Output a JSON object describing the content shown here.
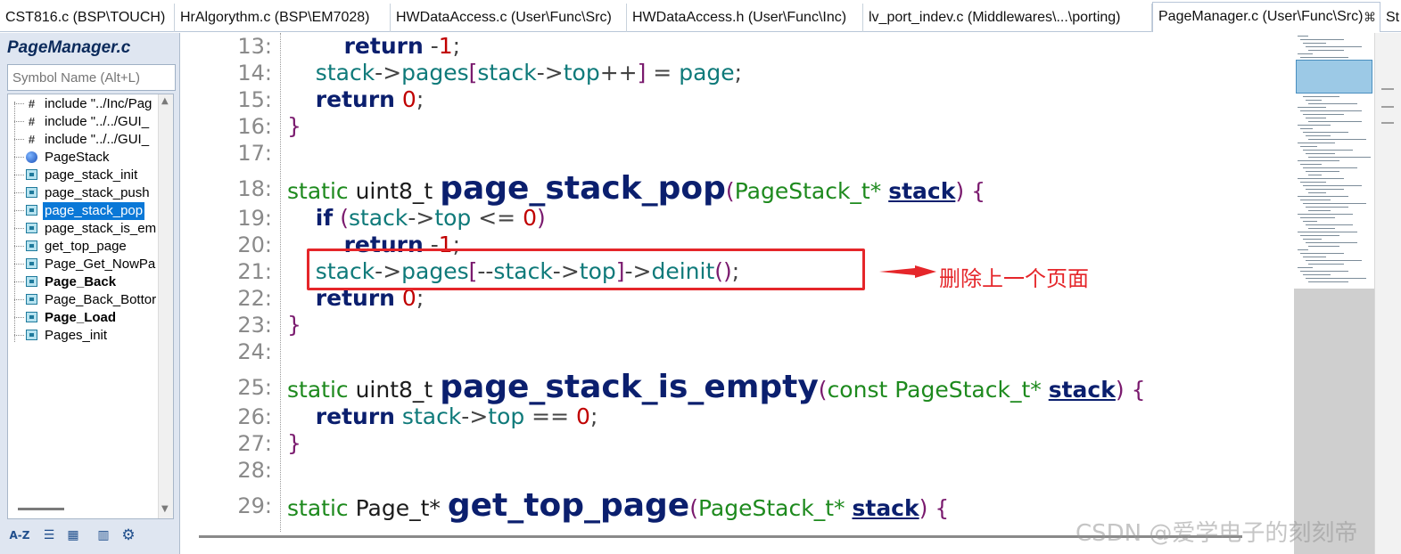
{
  "tabs": [
    {
      "label": "CST816.c (BSP\\TOUCH)",
      "active": false
    },
    {
      "label": "HrAlgorythm.c (BSP\\EM7028)",
      "active": false
    },
    {
      "label": "HWDataAccess.c (User\\Func\\Src)",
      "active": false
    },
    {
      "label": "HWDataAccess.h (User\\Func\\Inc)",
      "active": false
    },
    {
      "label": "lv_port_indev.c (Middlewares\\...\\porting)",
      "active": false
    },
    {
      "label": "PageManager.c (User\\Func\\Src)",
      "active": true
    },
    {
      "label": "St",
      "active": false
    }
  ],
  "tab_close_glyph": "⌘",
  "symbol_panel": {
    "title": "PageManager.c",
    "search_placeholder": "Symbol Name (Alt+L)",
    "items": [
      {
        "label": "include \"../Inc/Pag",
        "icon": "include-hash-icon",
        "bold": false,
        "selected": false
      },
      {
        "label": "include \"../../GUI_",
        "icon": "include-hash-icon",
        "bold": false,
        "selected": false
      },
      {
        "label": "include \"../../GUI_",
        "icon": "include-hash-icon",
        "bold": false,
        "selected": false
      },
      {
        "label": "PageStack",
        "icon": "struct-globe-icon",
        "bold": false,
        "selected": false
      },
      {
        "label": "page_stack_init",
        "icon": "function-icon",
        "bold": false,
        "selected": false
      },
      {
        "label": "page_stack_push",
        "icon": "function-icon",
        "bold": false,
        "selected": false
      },
      {
        "label": "page_stack_pop",
        "icon": "function-icon",
        "bold": false,
        "selected": true
      },
      {
        "label": "page_stack_is_em",
        "icon": "function-icon",
        "bold": false,
        "selected": false
      },
      {
        "label": "get_top_page",
        "icon": "function-icon",
        "bold": false,
        "selected": false
      },
      {
        "label": "Page_Get_NowPa",
        "icon": "function-icon",
        "bold": false,
        "selected": false
      },
      {
        "label": "Page_Back",
        "icon": "function-icon",
        "bold": true,
        "selected": false
      },
      {
        "label": "Page_Back_Bottor",
        "icon": "function-icon",
        "bold": false,
        "selected": false
      },
      {
        "label": "Page_Load",
        "icon": "function-icon",
        "bold": true,
        "selected": false
      },
      {
        "label": "Pages_init",
        "icon": "function-icon",
        "bold": false,
        "selected": false
      }
    ],
    "toolbar": [
      "A-Z",
      "list-view",
      "category-view",
      "book",
      "settings"
    ]
  },
  "code_lines": [
    {
      "num": "13:",
      "tokens": [
        [
          "",
          "        "
        ],
        [
          "kw",
          "return"
        ],
        [
          "op",
          " -"
        ],
        [
          "num",
          "1"
        ],
        [
          "op",
          ";"
        ]
      ]
    },
    {
      "num": "14:",
      "tokens": [
        [
          "",
          "    "
        ],
        [
          "id",
          "stack"
        ],
        [
          "op",
          "->"
        ],
        [
          "id",
          "pages"
        ],
        [
          "br",
          "["
        ],
        [
          "id",
          "stack"
        ],
        [
          "op",
          "->"
        ],
        [
          "id",
          "top"
        ],
        [
          "op",
          "++"
        ],
        [
          "br",
          "]"
        ],
        [
          "op",
          " = "
        ],
        [
          "id",
          "page"
        ],
        [
          "op",
          ";"
        ]
      ]
    },
    {
      "num": "15:",
      "tokens": [
        [
          "",
          "    "
        ],
        [
          "kw",
          "return"
        ],
        [
          "op",
          " "
        ],
        [
          "num",
          "0"
        ],
        [
          "op",
          ";"
        ]
      ]
    },
    {
      "num": "16:",
      "tokens": [
        [
          "br",
          "}"
        ]
      ]
    },
    {
      "num": "17:",
      "tokens": []
    },
    {
      "num": "18:",
      "tokens": [
        [
          "par",
          "static"
        ],
        [
          "ty",
          " uint8_t "
        ],
        [
          "fn",
          "page_stack_pop"
        ],
        [
          "br",
          "("
        ],
        [
          "par",
          "PageStack_t*"
        ],
        [
          "op",
          " "
        ],
        [
          "par-u",
          "stack"
        ],
        [
          "br",
          ")"
        ],
        [
          "op",
          " "
        ],
        [
          "br",
          "{"
        ]
      ]
    },
    {
      "num": "19:",
      "tokens": [
        [
          "",
          "    "
        ],
        [
          "kw",
          "if"
        ],
        [
          "op",
          " "
        ],
        [
          "br",
          "("
        ],
        [
          "id",
          "stack"
        ],
        [
          "op",
          "->"
        ],
        [
          "id",
          "top"
        ],
        [
          "op",
          " <= "
        ],
        [
          "num",
          "0"
        ],
        [
          "br",
          ")"
        ]
      ]
    },
    {
      "num": "20:",
      "tokens": [
        [
          "",
          "        "
        ],
        [
          "kw",
          "return"
        ],
        [
          "op",
          " -"
        ],
        [
          "num",
          "1"
        ],
        [
          "op",
          ";"
        ]
      ]
    },
    {
      "num": "21:",
      "tokens": [
        [
          "",
          "    "
        ],
        [
          "id",
          "stack"
        ],
        [
          "op",
          "->"
        ],
        [
          "id",
          "pages"
        ],
        [
          "br",
          "["
        ],
        [
          "op",
          "--"
        ],
        [
          "id",
          "stack"
        ],
        [
          "op",
          "->"
        ],
        [
          "id",
          "top"
        ],
        [
          "br",
          "]"
        ],
        [
          "op",
          "->"
        ],
        [
          "id",
          "deinit"
        ],
        [
          "br",
          "()"
        ],
        [
          "op",
          ";"
        ]
      ]
    },
    {
      "num": "22:",
      "tokens": [
        [
          "",
          "    "
        ],
        [
          "kw",
          "return"
        ],
        [
          "op",
          " "
        ],
        [
          "num",
          "0"
        ],
        [
          "op",
          ";"
        ]
      ]
    },
    {
      "num": "23:",
      "tokens": [
        [
          "br",
          "}"
        ]
      ]
    },
    {
      "num": "24:",
      "tokens": []
    },
    {
      "num": "25:",
      "tokens": [
        [
          "par",
          "static"
        ],
        [
          "ty",
          " uint8_t "
        ],
        [
          "fn",
          "page_stack_is_empty"
        ],
        [
          "br",
          "("
        ],
        [
          "par",
          "const PageStack_t*"
        ],
        [
          "op",
          " "
        ],
        [
          "par-u",
          "stack"
        ],
        [
          "br",
          ")"
        ],
        [
          "op",
          " "
        ],
        [
          "br",
          "{"
        ]
      ]
    },
    {
      "num": "26:",
      "tokens": [
        [
          "",
          "    "
        ],
        [
          "kw",
          "return"
        ],
        [
          "op",
          " "
        ],
        [
          "id",
          "stack"
        ],
        [
          "op",
          "->"
        ],
        [
          "id",
          "top"
        ],
        [
          "op",
          " == "
        ],
        [
          "num",
          "0"
        ],
        [
          "op",
          ";"
        ]
      ]
    },
    {
      "num": "27:",
      "tokens": [
        [
          "br",
          "}"
        ]
      ]
    },
    {
      "num": "28:",
      "tokens": []
    },
    {
      "num": "29:",
      "tokens": [
        [
          "par",
          "static"
        ],
        [
          "ty",
          " Page_t* "
        ],
        [
          "fn",
          "get_top_page"
        ],
        [
          "br",
          "("
        ],
        [
          "par",
          "PageStack_t*"
        ],
        [
          "op",
          " "
        ],
        [
          "par-u",
          "stack"
        ],
        [
          "br",
          ")"
        ],
        [
          "op",
          " "
        ],
        [
          "br",
          "{"
        ]
      ]
    }
  ],
  "annotation": {
    "text": "删除上一个页面",
    "color": "#e5262a"
  },
  "watermark": "CSDN @爱学电子的刻刻帝",
  "colors": {
    "selection": "#0a78d7",
    "panel_bg": "#dfe6f1",
    "keyword": "#0b1f6e",
    "identifier": "#0f7a7a",
    "number": "#c00000",
    "param": "#1e8a1e"
  }
}
